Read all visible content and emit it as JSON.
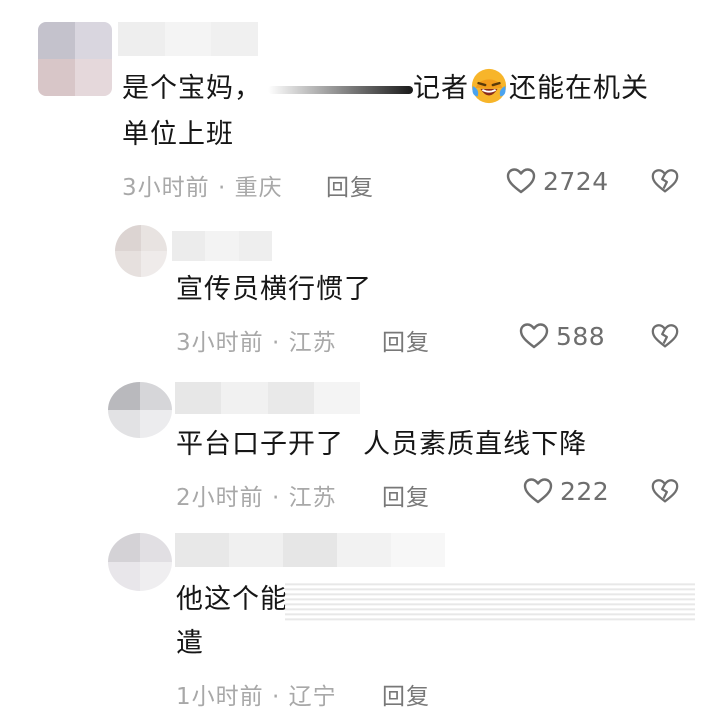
{
  "comments": [
    {
      "text_before": "是个宝妈，",
      "text_after": "记者",
      "text_after_emoji": "还能在机关",
      "text_line2": "单位上班",
      "emoji": "laughing-crying-emoji",
      "time": "3小时前",
      "location": "重庆",
      "reply_label": "回复",
      "likes": "2724"
    },
    {
      "text": "宣传员横行惯了",
      "time": "3小时前",
      "location": "江苏",
      "reply_label": "回复",
      "likes": "588"
    },
    {
      "text": "平台口子开了  人员素质直线下降",
      "time": "2小时前",
      "location": "江苏",
      "reply_label": "回复",
      "likes": "222"
    },
    {
      "text_visible": "他这个能",
      "text_line2": "遣",
      "time": "1小时前",
      "location": "辽宁",
      "reply_label": "回复"
    }
  ],
  "separator": "·",
  "colors": {
    "text": "#161616",
    "meta": "#a8a8a8",
    "reply": "#787878",
    "icon": "#6e6e6e"
  }
}
